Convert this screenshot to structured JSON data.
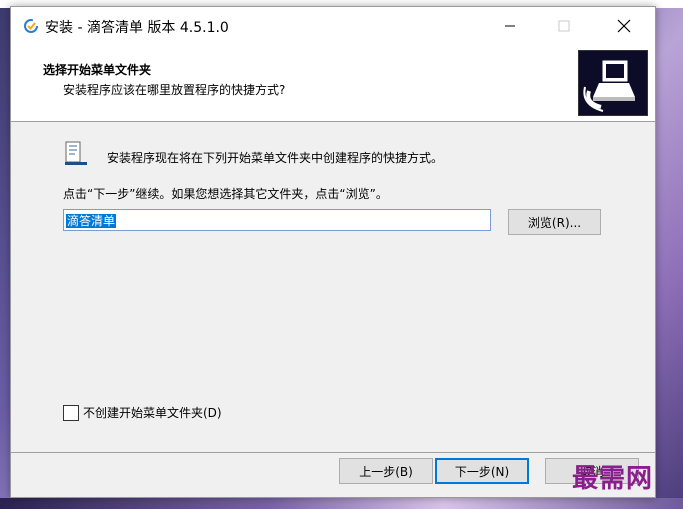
{
  "window": {
    "title": "安装 - 滴答清单 版本 4.5.1.0"
  },
  "header": {
    "title": "选择开始菜单文件夹",
    "subtitle": "安装程序应该在哪里放置程序的快捷方式?"
  },
  "content": {
    "description": "安装程序现在将在下列开始菜单文件夹中创建程序的快捷方式。",
    "instruction": "点击“下一步”继续。如果您想选择其它文件夹，点击“浏览”。",
    "folder_value": "滴答清单",
    "browse_label": "浏览(R)...",
    "checkbox_label": "不创建开始菜单文件夹(D)",
    "checkbox_checked": false
  },
  "footer": {
    "back_label": "上一步(B)",
    "next_label": "下一步(N)",
    "cancel_label": "取消"
  },
  "watermark": "最需网",
  "colors": {
    "accent": "#0078d7",
    "selection": "#0078d7",
    "watermark": "#8a1e8c"
  },
  "icons": {
    "app": "dida-check-icon",
    "minimize": "minimize-icon",
    "maximize": "maximize-icon",
    "close": "close-icon",
    "header_logo": "installer-computer-icon",
    "folder": "start-menu-folder-icon"
  }
}
